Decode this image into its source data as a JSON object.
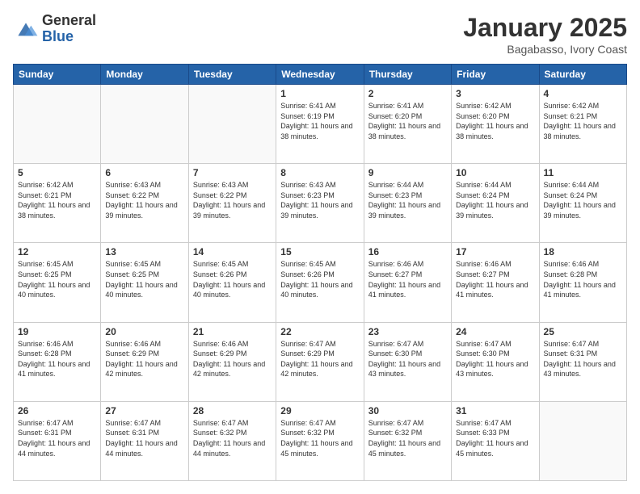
{
  "logo": {
    "general": "General",
    "blue": "Blue"
  },
  "title": {
    "month": "January 2025",
    "location": "Bagabasso, Ivory Coast"
  },
  "days_of_week": [
    "Sunday",
    "Monday",
    "Tuesday",
    "Wednesday",
    "Thursday",
    "Friday",
    "Saturday"
  ],
  "weeks": [
    [
      {
        "day": "",
        "sunrise": "",
        "sunset": "",
        "daylight": ""
      },
      {
        "day": "",
        "sunrise": "",
        "sunset": "",
        "daylight": ""
      },
      {
        "day": "",
        "sunrise": "",
        "sunset": "",
        "daylight": ""
      },
      {
        "day": "1",
        "sunrise": "Sunrise: 6:41 AM",
        "sunset": "Sunset: 6:19 PM",
        "daylight": "Daylight: 11 hours and 38 minutes."
      },
      {
        "day": "2",
        "sunrise": "Sunrise: 6:41 AM",
        "sunset": "Sunset: 6:20 PM",
        "daylight": "Daylight: 11 hours and 38 minutes."
      },
      {
        "day": "3",
        "sunrise": "Sunrise: 6:42 AM",
        "sunset": "Sunset: 6:20 PM",
        "daylight": "Daylight: 11 hours and 38 minutes."
      },
      {
        "day": "4",
        "sunrise": "Sunrise: 6:42 AM",
        "sunset": "Sunset: 6:21 PM",
        "daylight": "Daylight: 11 hours and 38 minutes."
      }
    ],
    [
      {
        "day": "5",
        "sunrise": "Sunrise: 6:42 AM",
        "sunset": "Sunset: 6:21 PM",
        "daylight": "Daylight: 11 hours and 38 minutes."
      },
      {
        "day": "6",
        "sunrise": "Sunrise: 6:43 AM",
        "sunset": "Sunset: 6:22 PM",
        "daylight": "Daylight: 11 hours and 39 minutes."
      },
      {
        "day": "7",
        "sunrise": "Sunrise: 6:43 AM",
        "sunset": "Sunset: 6:22 PM",
        "daylight": "Daylight: 11 hours and 39 minutes."
      },
      {
        "day": "8",
        "sunrise": "Sunrise: 6:43 AM",
        "sunset": "Sunset: 6:23 PM",
        "daylight": "Daylight: 11 hours and 39 minutes."
      },
      {
        "day": "9",
        "sunrise": "Sunrise: 6:44 AM",
        "sunset": "Sunset: 6:23 PM",
        "daylight": "Daylight: 11 hours and 39 minutes."
      },
      {
        "day": "10",
        "sunrise": "Sunrise: 6:44 AM",
        "sunset": "Sunset: 6:24 PM",
        "daylight": "Daylight: 11 hours and 39 minutes."
      },
      {
        "day": "11",
        "sunrise": "Sunrise: 6:44 AM",
        "sunset": "Sunset: 6:24 PM",
        "daylight": "Daylight: 11 hours and 39 minutes."
      }
    ],
    [
      {
        "day": "12",
        "sunrise": "Sunrise: 6:45 AM",
        "sunset": "Sunset: 6:25 PM",
        "daylight": "Daylight: 11 hours and 40 minutes."
      },
      {
        "day": "13",
        "sunrise": "Sunrise: 6:45 AM",
        "sunset": "Sunset: 6:25 PM",
        "daylight": "Daylight: 11 hours and 40 minutes."
      },
      {
        "day": "14",
        "sunrise": "Sunrise: 6:45 AM",
        "sunset": "Sunset: 6:26 PM",
        "daylight": "Daylight: 11 hours and 40 minutes."
      },
      {
        "day": "15",
        "sunrise": "Sunrise: 6:45 AM",
        "sunset": "Sunset: 6:26 PM",
        "daylight": "Daylight: 11 hours and 40 minutes."
      },
      {
        "day": "16",
        "sunrise": "Sunrise: 6:46 AM",
        "sunset": "Sunset: 6:27 PM",
        "daylight": "Daylight: 11 hours and 41 minutes."
      },
      {
        "day": "17",
        "sunrise": "Sunrise: 6:46 AM",
        "sunset": "Sunset: 6:27 PM",
        "daylight": "Daylight: 11 hours and 41 minutes."
      },
      {
        "day": "18",
        "sunrise": "Sunrise: 6:46 AM",
        "sunset": "Sunset: 6:28 PM",
        "daylight": "Daylight: 11 hours and 41 minutes."
      }
    ],
    [
      {
        "day": "19",
        "sunrise": "Sunrise: 6:46 AM",
        "sunset": "Sunset: 6:28 PM",
        "daylight": "Daylight: 11 hours and 41 minutes."
      },
      {
        "day": "20",
        "sunrise": "Sunrise: 6:46 AM",
        "sunset": "Sunset: 6:29 PM",
        "daylight": "Daylight: 11 hours and 42 minutes."
      },
      {
        "day": "21",
        "sunrise": "Sunrise: 6:46 AM",
        "sunset": "Sunset: 6:29 PM",
        "daylight": "Daylight: 11 hours and 42 minutes."
      },
      {
        "day": "22",
        "sunrise": "Sunrise: 6:47 AM",
        "sunset": "Sunset: 6:29 PM",
        "daylight": "Daylight: 11 hours and 42 minutes."
      },
      {
        "day": "23",
        "sunrise": "Sunrise: 6:47 AM",
        "sunset": "Sunset: 6:30 PM",
        "daylight": "Daylight: 11 hours and 43 minutes."
      },
      {
        "day": "24",
        "sunrise": "Sunrise: 6:47 AM",
        "sunset": "Sunset: 6:30 PM",
        "daylight": "Daylight: 11 hours and 43 minutes."
      },
      {
        "day": "25",
        "sunrise": "Sunrise: 6:47 AM",
        "sunset": "Sunset: 6:31 PM",
        "daylight": "Daylight: 11 hours and 43 minutes."
      }
    ],
    [
      {
        "day": "26",
        "sunrise": "Sunrise: 6:47 AM",
        "sunset": "Sunset: 6:31 PM",
        "daylight": "Daylight: 11 hours and 44 minutes."
      },
      {
        "day": "27",
        "sunrise": "Sunrise: 6:47 AM",
        "sunset": "Sunset: 6:31 PM",
        "daylight": "Daylight: 11 hours and 44 minutes."
      },
      {
        "day": "28",
        "sunrise": "Sunrise: 6:47 AM",
        "sunset": "Sunset: 6:32 PM",
        "daylight": "Daylight: 11 hours and 44 minutes."
      },
      {
        "day": "29",
        "sunrise": "Sunrise: 6:47 AM",
        "sunset": "Sunset: 6:32 PM",
        "daylight": "Daylight: 11 hours and 45 minutes."
      },
      {
        "day": "30",
        "sunrise": "Sunrise: 6:47 AM",
        "sunset": "Sunset: 6:32 PM",
        "daylight": "Daylight: 11 hours and 45 minutes."
      },
      {
        "day": "31",
        "sunrise": "Sunrise: 6:47 AM",
        "sunset": "Sunset: 6:33 PM",
        "daylight": "Daylight: 11 hours and 45 minutes."
      },
      {
        "day": "",
        "sunrise": "",
        "sunset": "",
        "daylight": ""
      }
    ]
  ]
}
